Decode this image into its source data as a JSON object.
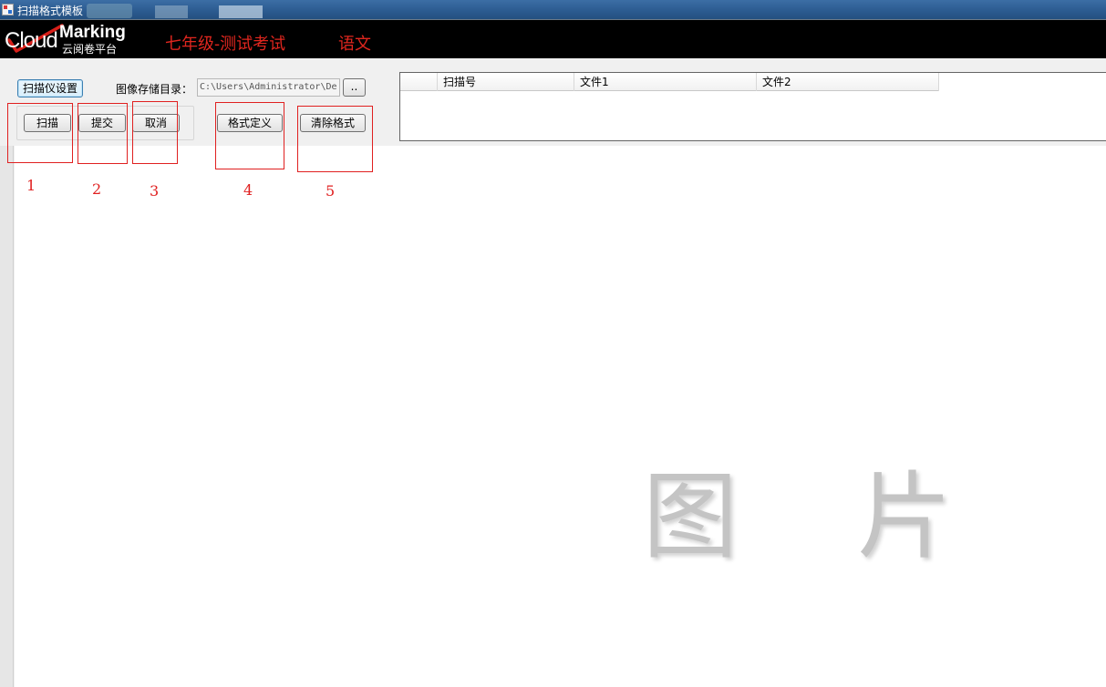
{
  "window": {
    "title": "扫描格式模板"
  },
  "banner": {
    "logo_cloud": "Cloud",
    "logo_marking": "Marking",
    "logo_subtitle": "云阅卷平台",
    "exam_title": "七年级-测试考试",
    "subject": "语文"
  },
  "toolbar": {
    "scanner_settings_label": "扫描仪设置",
    "dir_label": "图像存储目录：",
    "dir_value": "C:\\Users\\Administrator\\De",
    "browse_label": "..",
    "scan_label": "扫描",
    "submit_label": "提交",
    "cancel_label": "取消",
    "format_define_label": "格式定义",
    "clear_format_label": "清除格式"
  },
  "grid": {
    "columns": [
      "",
      "扫描号",
      "文件1",
      "文件2"
    ]
  },
  "annotations": [
    "1",
    "2",
    "3",
    "4",
    "5"
  ],
  "watermark": [
    "图",
    "片"
  ],
  "colors": {
    "annotation": "#e02020",
    "banner_text": "#e0261e",
    "banner_bg": "#000000"
  }
}
